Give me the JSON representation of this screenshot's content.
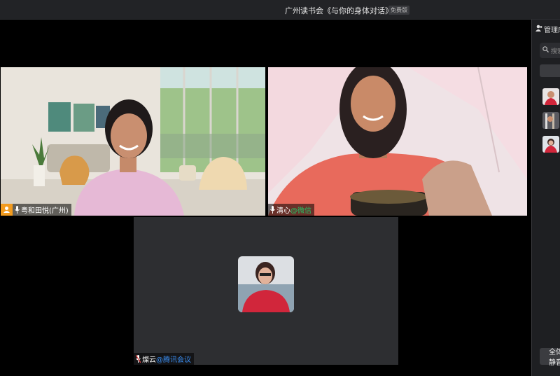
{
  "window": {
    "title": "广州读书会《与你的身体对话》",
    "badge": "免费版"
  },
  "participants": [
    {
      "name": "粤和田悦(广州)",
      "source": "",
      "is_host": true
    },
    {
      "name": "清心",
      "source": "@微信"
    },
    {
      "name": "燦云",
      "source": "@腾讯会议"
    }
  ],
  "sidebar": {
    "header": "管理成员",
    "search_placeholder": "搜索",
    "all_button": "全体静音"
  },
  "colors": {
    "active_speaker": "#1fb35d",
    "host_badge": "#f29b1f",
    "wechat": "#24c466",
    "tencent": "#3a8df0"
  }
}
